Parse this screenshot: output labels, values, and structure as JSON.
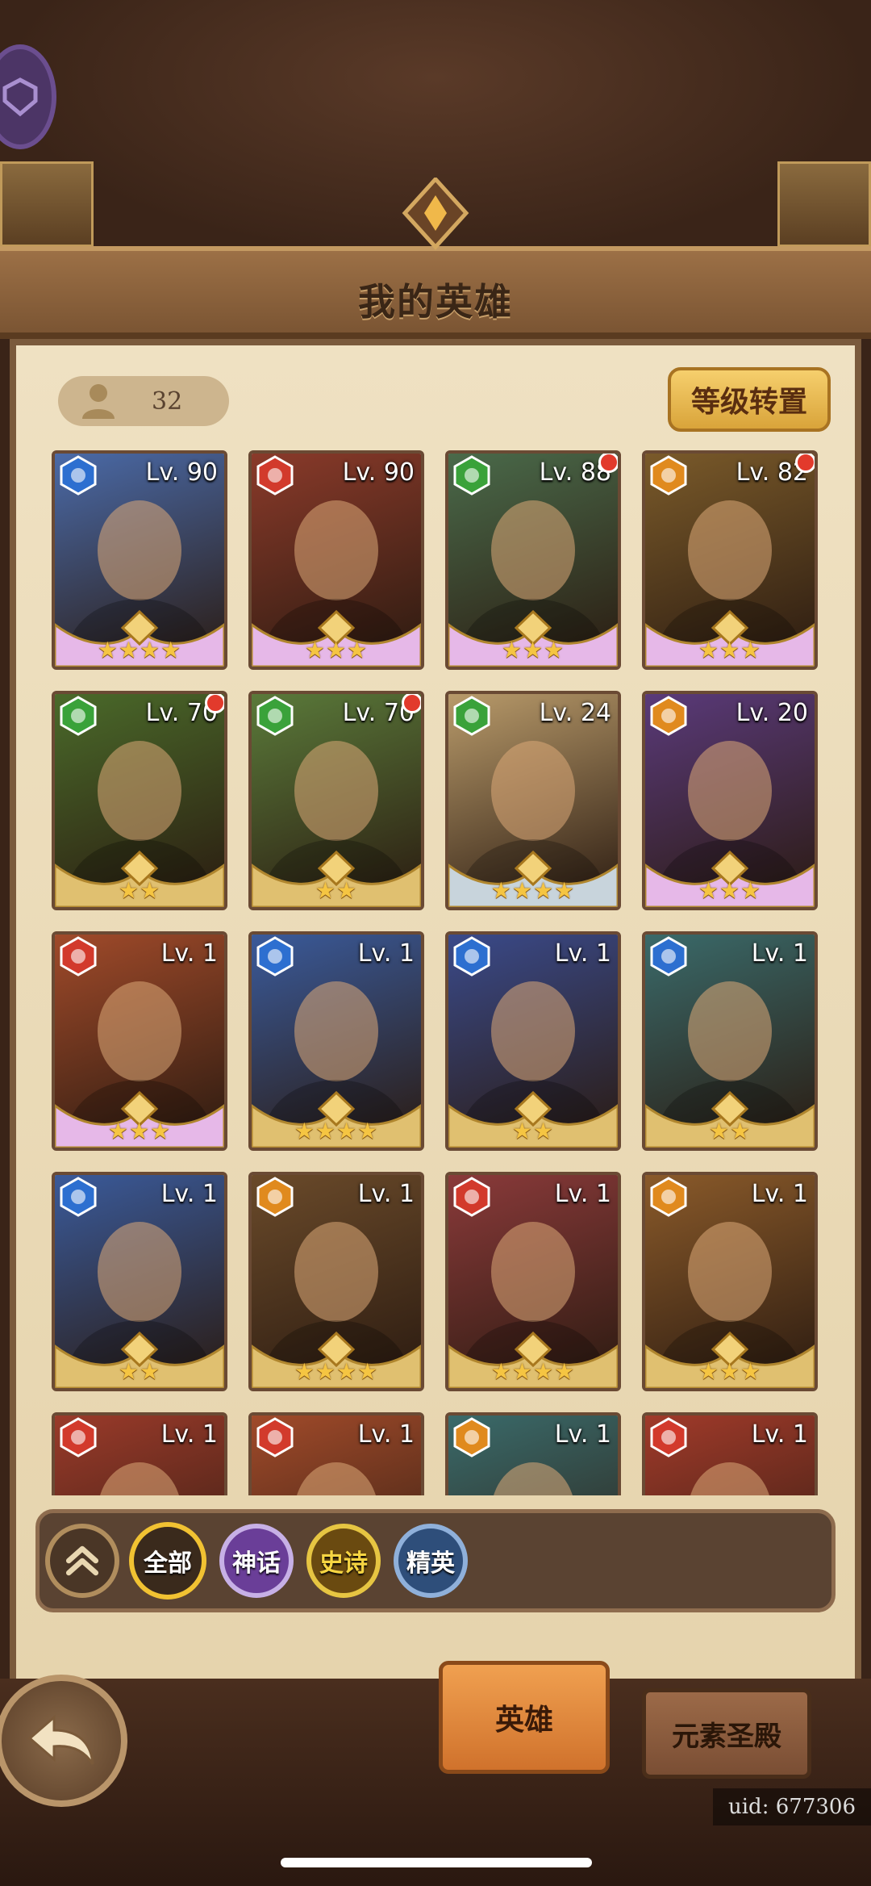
{
  "title": "我的英雄",
  "hero_count": "32",
  "level_transfer_label": "等级转置",
  "element_colors": {
    "water": "#2d6fd0",
    "fire": "#d23a2c",
    "wind": "#3aa23a",
    "earth": "#e08a1e"
  },
  "heroes": [
    {
      "level": "Lv. 90",
      "element": "water",
      "stars": "★★★★",
      "notify": false,
      "rarity": "mythic",
      "bg": "#4a6aa8"
    },
    {
      "level": "Lv. 90",
      "element": "fire",
      "stars": "★★★",
      "notify": false,
      "rarity": "mythic",
      "bg": "#8a3a2a"
    },
    {
      "level": "Lv. 88",
      "element": "wind",
      "stars": "★★★",
      "notify": true,
      "rarity": "mythic",
      "bg": "#4a6a4a"
    },
    {
      "level": "Lv. 82",
      "element": "earth",
      "stars": "★★★",
      "notify": true,
      "rarity": "mythic",
      "bg": "#7a5a2a"
    },
    {
      "level": "Lv. 70",
      "element": "wind",
      "stars": "★★",
      "notify": true,
      "rarity": "epic",
      "bg": "#4a6a2a"
    },
    {
      "level": "Lv. 70",
      "element": "wind",
      "stars": "★★",
      "notify": true,
      "rarity": "epic",
      "bg": "#5a7a3a"
    },
    {
      "level": "Lv. 24",
      "element": "wind",
      "stars": "★★★★",
      "notify": false,
      "rarity": "elite",
      "bg": "#b89a6a"
    },
    {
      "level": "Lv. 20",
      "element": "earth",
      "stars": "★★★",
      "notify": false,
      "rarity": "mythic",
      "bg": "#5a3a7a"
    },
    {
      "level": "Lv. 1",
      "element": "fire",
      "stars": "★★★",
      "notify": false,
      "rarity": "mythic",
      "bg": "#a04a2a"
    },
    {
      "level": "Lv. 1",
      "element": "water",
      "stars": "★★★★",
      "notify": false,
      "rarity": "epic",
      "bg": "#3a5a9a"
    },
    {
      "level": "Lv. 1",
      "element": "water",
      "stars": "★★",
      "notify": false,
      "rarity": "epic",
      "bg": "#3a4a8a"
    },
    {
      "level": "Lv. 1",
      "element": "water",
      "stars": "★★",
      "notify": false,
      "rarity": "epic",
      "bg": "#3a6a6a"
    },
    {
      "level": "Lv. 1",
      "element": "water",
      "stars": "★★",
      "notify": false,
      "rarity": "epic",
      "bg": "#3a5a9a"
    },
    {
      "level": "Lv. 1",
      "element": "earth",
      "stars": "★★★★",
      "notify": false,
      "rarity": "epic",
      "bg": "#6a4a2a"
    },
    {
      "level": "Lv. 1",
      "element": "fire",
      "stars": "★★★★",
      "notify": false,
      "rarity": "epic",
      "bg": "#8a3a3a"
    },
    {
      "level": "Lv. 1",
      "element": "earth",
      "stars": "★★★",
      "notify": false,
      "rarity": "epic",
      "bg": "#8a5a2a"
    },
    {
      "level": "Lv. 1",
      "element": "fire",
      "stars": "",
      "notify": false,
      "rarity": "epic",
      "bg": "#9a3a2a"
    },
    {
      "level": "Lv. 1",
      "element": "fire",
      "stars": "",
      "notify": false,
      "rarity": "epic",
      "bg": "#a04a2a"
    },
    {
      "level": "Lv. 1",
      "element": "earth",
      "stars": "",
      "notify": false,
      "rarity": "epic",
      "bg": "#3a6a6a"
    },
    {
      "level": "Lv. 1",
      "element": "fire",
      "stars": "",
      "notify": false,
      "rarity": "epic",
      "bg": "#a03a2a"
    }
  ],
  "filters": {
    "all": "全部",
    "myth": "神话",
    "epic": "史诗",
    "elite": "精英"
  },
  "tabs": {
    "hero": "英雄",
    "temple": "元素圣殿"
  },
  "uid": "uid: 677306"
}
